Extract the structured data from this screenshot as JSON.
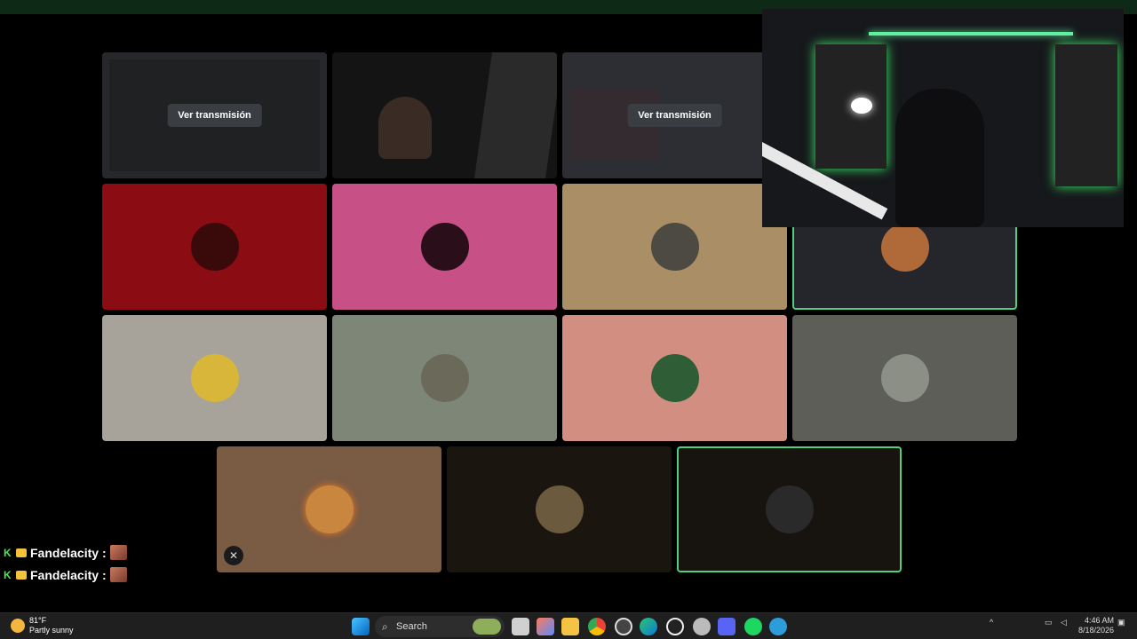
{
  "stage": {
    "watch_label": "Ver transmisión"
  },
  "tiles": [
    {
      "kind": "screenshare",
      "bg": "#2b2d31"
    },
    {
      "kind": "camera",
      "bg": "#1a1a1a"
    },
    {
      "kind": "screenshare",
      "bg": "#2f3136"
    },
    {
      "kind": "avatar",
      "bg": "#8b0c12",
      "avatar_color": "#3a0a0a"
    },
    {
      "kind": "avatar",
      "bg": "#c75186",
      "avatar_color": "#2a0f1a"
    },
    {
      "kind": "avatar",
      "bg": "#a98e66",
      "avatar_color": "#4d4a43"
    },
    {
      "kind": "avatar",
      "bg": "#25262c",
      "avatar_color": "#b06a3a",
      "speaking": true
    },
    {
      "kind": "avatar",
      "bg": "#a7a39b",
      "avatar_color": "#d7b63a"
    },
    {
      "kind": "avatar",
      "bg": "#7d8677",
      "avatar_color": "#6b6a5a"
    },
    {
      "kind": "avatar",
      "bg": "#d18e81",
      "avatar_color": "#2f5e36"
    },
    {
      "kind": "avatar",
      "bg": "#5d5e57",
      "avatar_color": "#8b8f86"
    },
    {
      "kind": "avatar",
      "bg": "#7a5b44",
      "avatar_color": "#c8863e",
      "muted": true
    },
    {
      "kind": "avatar",
      "bg": "#1b1510",
      "avatar_color": "#6c5a3e"
    },
    {
      "kind": "avatar",
      "bg": "#17140f",
      "avatar_color": "#2a2a2a",
      "speaking": true
    }
  ],
  "chat": [
    {
      "user": "Fandelacity",
      "separator": ":"
    },
    {
      "user": "Fandelacity",
      "separator": ":"
    }
  ],
  "taskbar": {
    "weather_temp": "81°F",
    "weather_desc": "Partly sunny",
    "search_label": "Search",
    "time": "4:46 AM",
    "date": "8/18/2026",
    "icons": [
      "windows-start-icon",
      "task-view-icon",
      "copilot-icon",
      "file-explorer-icon",
      "chrome-icon",
      "app-icon",
      "edge-icon",
      "obs-icon",
      "settings-icon",
      "discord-icon",
      "spotify-icon",
      "browser-icon"
    ]
  },
  "colors": {
    "speaking_border": "#4ed07e",
    "taskbar_bg": "#1f1f1f",
    "accent_green": "#52e05f"
  }
}
